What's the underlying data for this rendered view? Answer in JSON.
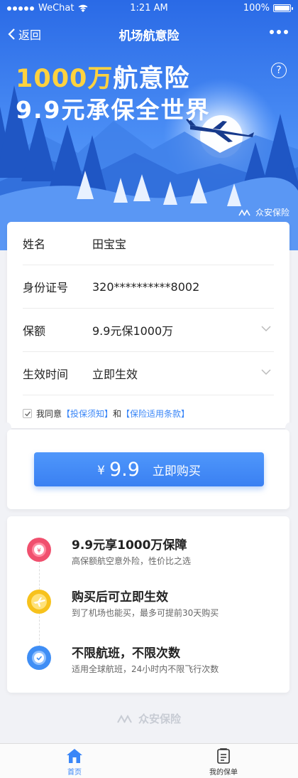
{
  "status_bar": {
    "carrier": "WeChat",
    "time": "1:21 AM",
    "battery": "100%",
    "battery_level": 1.0
  },
  "nav": {
    "back_label": "返回",
    "title": "机场航意险"
  },
  "hero": {
    "headline_amount": "1000万",
    "headline_rest": "航意险",
    "subline": "9.9元承保全世界",
    "help_label": "?",
    "brand": "众安保险"
  },
  "form": {
    "rows": [
      {
        "label": "姓名",
        "value": "田宝宝"
      },
      {
        "label": "身份证号",
        "value": "320**********8002"
      },
      {
        "label": "保额",
        "value": "9.9元保1000万"
      },
      {
        "label": "生效时间",
        "value": "立即生效"
      }
    ],
    "agree": {
      "checked": true,
      "prefix": "我同意",
      "link1": "【投保须知】",
      "conj": "和",
      "link2": "【保险适用条款】"
    }
  },
  "buy": {
    "currency": "¥",
    "price": "9.9",
    "label": "立即购买"
  },
  "features": [
    {
      "icon": "coin-icon",
      "title": "9.9元享1000万保障",
      "desc": "高保额航空意外险，性价比之选",
      "color": "#f0506e"
    },
    {
      "icon": "airplane-icon",
      "title": "购买后可立即生效",
      "desc": "到了机场也能买，最多可提前30天购买",
      "color": "#f7c21c"
    },
    {
      "icon": "clock-icon",
      "title": "不限航班，不限次数",
      "desc": "适用全球航班，24小时内不限飞行次数",
      "color": "#3f8ef5"
    }
  ],
  "footer": {
    "brand": "众安保险"
  },
  "tabs": [
    {
      "label": "首页",
      "icon": "home-icon",
      "active": true
    },
    {
      "label": "我的保单",
      "icon": "policy-icon",
      "active": false
    }
  ],
  "colors": {
    "accent": "#3a86f7",
    "hero_top": "#2d6fe8",
    "gold": "#ffd23f"
  }
}
